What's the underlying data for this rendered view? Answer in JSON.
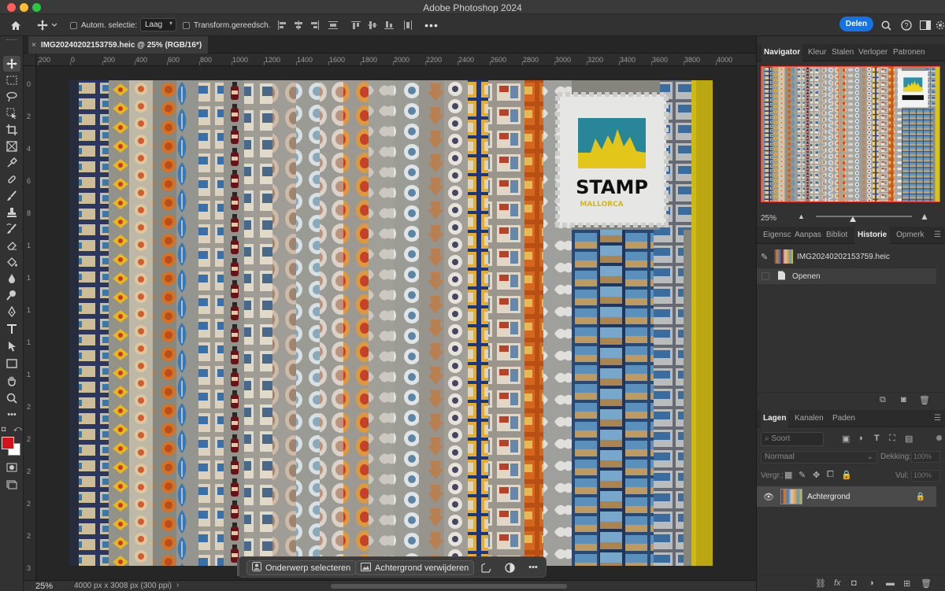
{
  "window": {
    "title": "Adobe Photoshop 2024"
  },
  "options_bar": {
    "auto_select_label": "Autom. selectie:",
    "auto_select_value": "Laag",
    "transform_label": "Transform.gereedsch.",
    "share_label": "Delen"
  },
  "document": {
    "tab_title": "IMG20240202153759.heic @ 25% (RGB/16*)",
    "zoom": "25%",
    "info": "4000 px x 3008 px (300 ppi)"
  },
  "ruler": {
    "h_labels": [
      "200",
      "0",
      "200",
      "400",
      "600",
      "800",
      "1000",
      "1200",
      "1400",
      "1600",
      "1800",
      "2000",
      "2200",
      "2400",
      "2600",
      "2800",
      "3000",
      "3200",
      "3400",
      "3600",
      "3800",
      "4000"
    ],
    "v_labels": [
      "0",
      "2",
      "4",
      "6",
      "8",
      "1",
      "1",
      "1",
      "1",
      "1",
      "2",
      "2",
      "2",
      "2",
      "2",
      "3"
    ]
  },
  "photo": {
    "sign_line1": "STAMP",
    "sign_line2": "MALLORCA"
  },
  "context_bar": {
    "select_subject": "Onderwerp selecteren",
    "remove_background": "Achtergrond verwijderen"
  },
  "navigator_panel": {
    "tabs": [
      "Navigator",
      "Kleur",
      "Stalen",
      "Verloper",
      "Patronen"
    ],
    "zoom": "25%"
  },
  "history_panel": {
    "tabs": [
      "Eigensc",
      "Aanpas",
      "Bibliot",
      "Historie",
      "Opmerk"
    ],
    "snapshot": "IMG20240202153759.heic",
    "steps": [
      "Openen"
    ]
  },
  "layers_panel": {
    "tabs": [
      "Lagen",
      "Kanalen",
      "Paden"
    ],
    "filter_placeholder": "Soort",
    "blend_mode": "Normaal",
    "opacity_label": "Dekking:",
    "opacity_value": "100%",
    "lock_label": "Vergr.:",
    "fill_label": "Vul:",
    "fill_value": "100%",
    "layers": [
      {
        "name": "Achtergrond",
        "visible": true,
        "locked": true
      }
    ]
  }
}
